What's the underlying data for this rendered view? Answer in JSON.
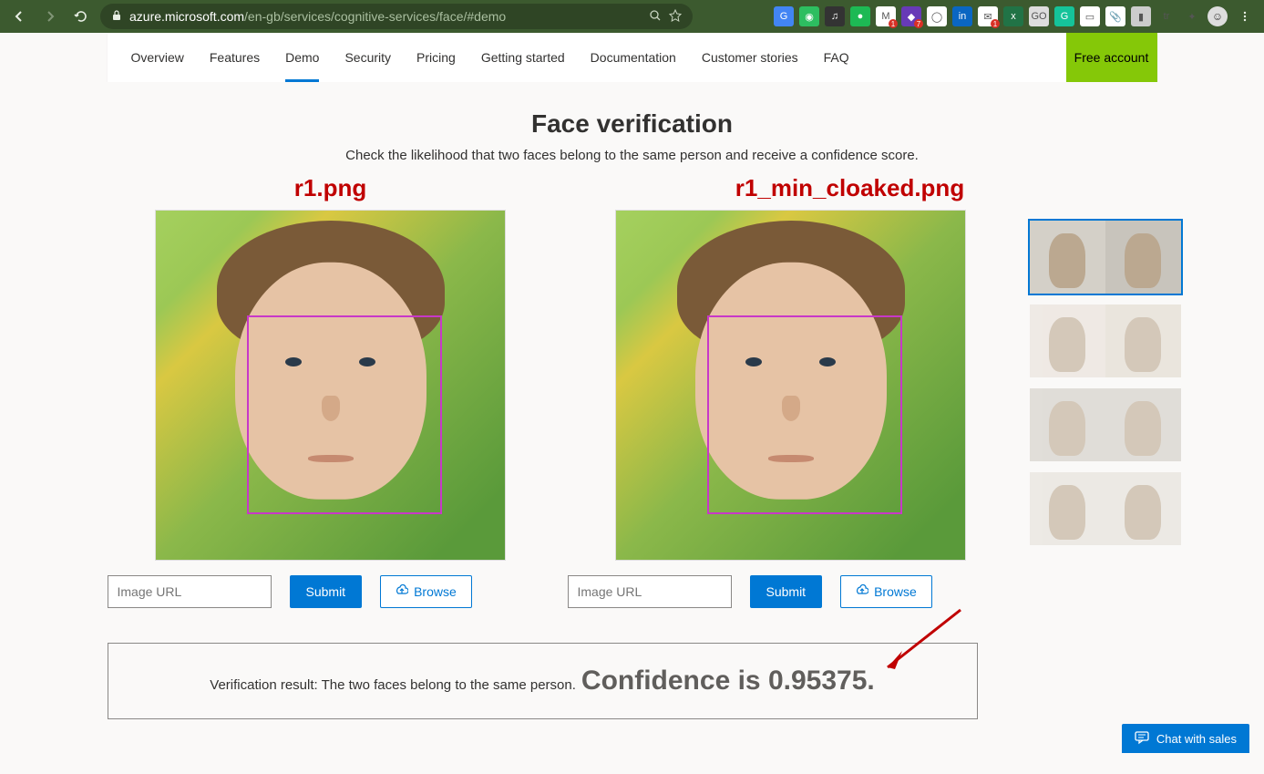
{
  "browser": {
    "url_host": "azure.microsoft.com",
    "url_path": "/en-gb/services/cognitive-services/face/#demo",
    "extensions": [
      {
        "name": "google-translate",
        "bg": "#4285f4",
        "glyph": "G"
      },
      {
        "name": "evernote",
        "bg": "#2dbe60",
        "glyph": "◉"
      },
      {
        "name": "headphones",
        "bg": "#333",
        "glyph": "♫"
      },
      {
        "name": "spotify",
        "bg": "#1db954",
        "glyph": "●"
      },
      {
        "name": "gmail",
        "bg": "#fff",
        "glyph": "M",
        "badge": "1"
      },
      {
        "name": "purple-ext",
        "bg": "#673ab7",
        "glyph": "◆",
        "badge": "7"
      },
      {
        "name": "circle-ext",
        "bg": "#fff",
        "glyph": "◯"
      },
      {
        "name": "linkedin",
        "bg": "#0a66c2",
        "glyph": "in"
      },
      {
        "name": "mail2",
        "bg": "#fff",
        "glyph": "✉",
        "badge": "1"
      },
      {
        "name": "excel",
        "bg": "#217346",
        "glyph": "x"
      },
      {
        "name": "go-ext",
        "bg": "#ddd",
        "glyph": "GO"
      },
      {
        "name": "grammarly",
        "bg": "#15c39a",
        "glyph": "G"
      },
      {
        "name": "doc-ext",
        "bg": "#fff",
        "glyph": "▭"
      },
      {
        "name": "pin-ext",
        "bg": "#fff",
        "glyph": "📎"
      },
      {
        "name": "bag-ext",
        "bg": "#ccc",
        "glyph": "▮"
      },
      {
        "name": "tr-ext",
        "bg": "transparent",
        "glyph": "tr"
      },
      {
        "name": "puzzle",
        "bg": "transparent",
        "glyph": "✦"
      }
    ]
  },
  "nav": {
    "tabs": [
      {
        "id": "overview",
        "label": "Overview"
      },
      {
        "id": "features",
        "label": "Features"
      },
      {
        "id": "demo",
        "label": "Demo",
        "active": true
      },
      {
        "id": "security",
        "label": "Security"
      },
      {
        "id": "pricing",
        "label": "Pricing"
      },
      {
        "id": "getting-started",
        "label": "Getting started"
      },
      {
        "id": "documentation",
        "label": "Documentation"
      },
      {
        "id": "customer-stories",
        "label": "Customer stories"
      },
      {
        "id": "faq",
        "label": "FAQ"
      }
    ],
    "cta": "Free account"
  },
  "page": {
    "title": "Face verification",
    "subtitle": "Check the likelihood that two faces belong to the same person and receive a confidence score."
  },
  "annotations": {
    "left": "r1.png",
    "right": "r1_min_cloaked.png"
  },
  "inputs": {
    "placeholder": "Image URL",
    "submit": "Submit",
    "browse": "Browse"
  },
  "result": {
    "label": "Verification result: The two faces belong to the same person. ",
    "confidence": "Confidence is 0.95375."
  },
  "chat": {
    "label": "Chat with sales"
  }
}
